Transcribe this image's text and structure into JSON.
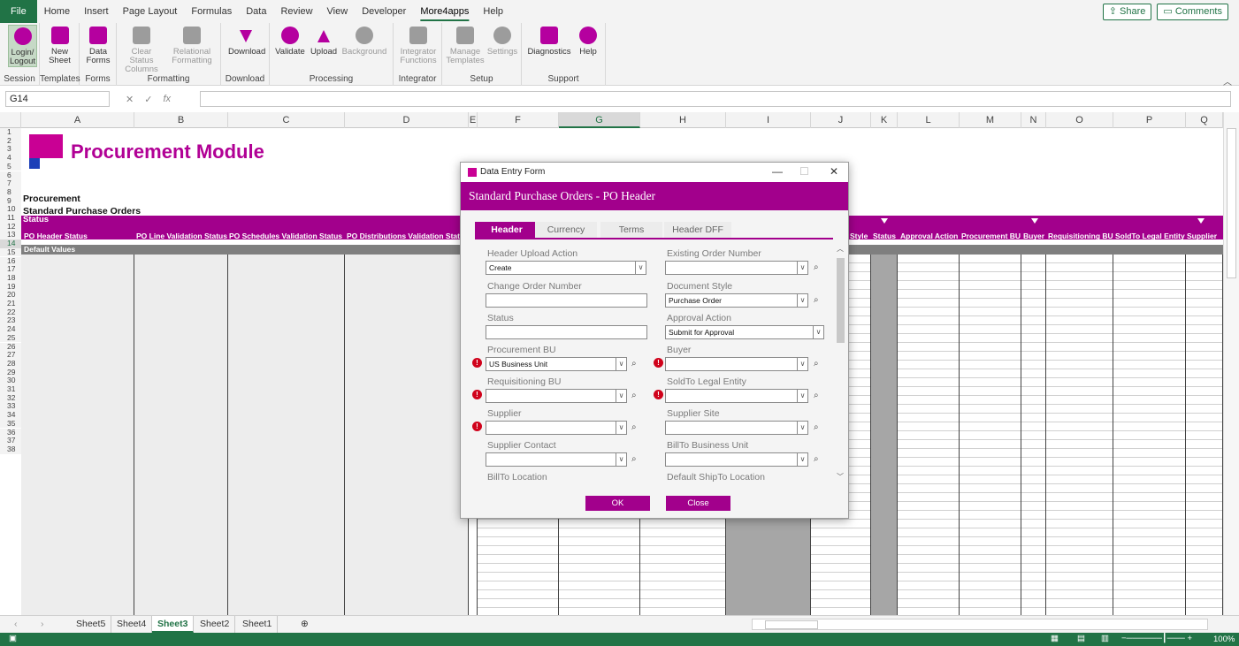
{
  "ribbon_tabs": [
    "File",
    "Home",
    "Insert",
    "Page Layout",
    "Formulas",
    "Data",
    "Review",
    "View",
    "Developer",
    "More4apps",
    "Help"
  ],
  "active_tab": "More4apps",
  "share_label": "Share",
  "comments_label": "Comments",
  "ribbon": {
    "session": {
      "label": "Session",
      "btn": "Login/\nLogout"
    },
    "templates": {
      "label": "Templates",
      "btn": "New Sheet"
    },
    "forms": {
      "label": "Forms",
      "btn": "Data Forms"
    },
    "formatting": {
      "label": "Formatting",
      "btn1": "Clear Status Columns",
      "btn2": "Relational Formatting"
    },
    "download": {
      "label": "Download",
      "btn": "Download"
    },
    "processing": {
      "label": "Processing",
      "btn1": "Validate",
      "btn2": "Upload",
      "btn3": "Background"
    },
    "integrator": {
      "label": "Integrator",
      "btn": "Integrator Functions"
    },
    "setup": {
      "label": "Setup",
      "btn1": "Manage Templates",
      "btn2": "Settings"
    },
    "support": {
      "label": "Support",
      "btn1": "Diagnostics",
      "btn2": "Help"
    }
  },
  "namebox": "G14",
  "fx_label": "fx",
  "columns": [
    "A",
    "B",
    "C",
    "D",
    "E",
    "F",
    "G",
    "H",
    "I",
    "J",
    "K",
    "L",
    "M",
    "N",
    "O",
    "P",
    "Q"
  ],
  "selected_column": "G",
  "rows": [
    "1",
    "2",
    "3",
    "4",
    "5",
    "6",
    "7",
    "8",
    "9",
    "10",
    "11",
    "12",
    "13",
    "14",
    "15",
    "16",
    "17",
    "18",
    "19",
    "20",
    "21",
    "22",
    "23",
    "24",
    "25",
    "26",
    "27",
    "28",
    "29",
    "30",
    "31",
    "32",
    "33",
    "34",
    "35",
    "36",
    "37",
    "38"
  ],
  "selected_row": "14",
  "sheet": {
    "title": "Procurement Module",
    "sub1": "Procurement",
    "sub2": "Standard Purchase Orders",
    "status_band": "Status",
    "col_headers_left": [
      "PO Header Status",
      "PO Line Validation Status",
      "PO Schedules Validation Status",
      "PO Distributions Validation Status"
    ],
    "col_headers_right": [
      "Style",
      "Status",
      "Approval Action",
      "Procurement BU",
      "Buyer",
      "Requisitioning BU",
      "SoldTo Legal Entity",
      "Supplier"
    ],
    "default_values": "Default Values"
  },
  "sheet_tabs": [
    "Sheet5",
    "Sheet4",
    "Sheet3",
    "Sheet2",
    "Sheet1"
  ],
  "active_sheet": "Sheet3",
  "zoom": "100%",
  "dialog": {
    "window_title": "Data Entry Form",
    "header": "Standard Purchase Orders - PO Header",
    "tabs": [
      "Header",
      "Currency",
      "Terms",
      "Header DFF"
    ],
    "active_tab": "Header",
    "fields": {
      "header_upload_action": {
        "label": "Header Upload Action",
        "value": "Create"
      },
      "existing_order_number": {
        "label": "Existing Order Number",
        "value": ""
      },
      "change_order_number": {
        "label": "Change Order Number",
        "value": ""
      },
      "document_style": {
        "label": "Document Style",
        "value": "Purchase Order"
      },
      "status": {
        "label": "Status",
        "value": ""
      },
      "approval_action": {
        "label": "Approval Action",
        "value": "Submit for Approval"
      },
      "procurement_bu": {
        "label": "Procurement BU",
        "value": "US Business Unit"
      },
      "buyer": {
        "label": "Buyer",
        "value": ""
      },
      "requisitioning_bu": {
        "label": "Requisitioning BU",
        "value": ""
      },
      "soldto_legal_entity": {
        "label": "SoldTo Legal Entity",
        "value": ""
      },
      "supplier": {
        "label": "Supplier",
        "value": ""
      },
      "supplier_site": {
        "label": "Supplier Site",
        "value": ""
      },
      "supplier_contact": {
        "label": "Supplier Contact",
        "value": ""
      },
      "billto_business_unit": {
        "label": "BillTo Business Unit",
        "value": ""
      },
      "billto_location": {
        "label": "BillTo Location"
      },
      "default_shipto_location": {
        "label": "Default ShipTo Location"
      }
    },
    "ok_label": "OK",
    "close_label": "Close"
  },
  "colors": {
    "accent": "#a2008c",
    "excel_green": "#217346",
    "error": "#d0021b"
  }
}
